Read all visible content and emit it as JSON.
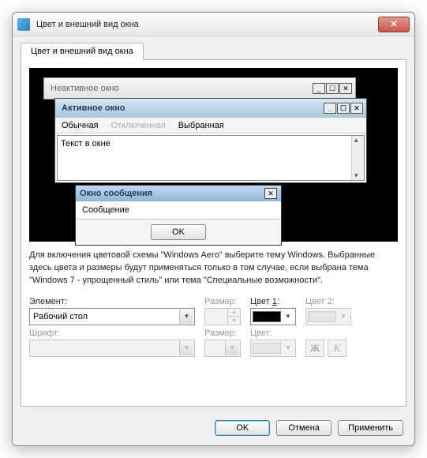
{
  "window": {
    "title": "Цвет и внешний вид окна",
    "close_glyph": "✕"
  },
  "tab": {
    "label": "Цвет и внешний вид окна"
  },
  "preview": {
    "inactive_title": "Неактивное окно",
    "active_title": "Активное окно",
    "menu_normal": "Обычная",
    "menu_disabled": "Отключенная",
    "menu_selected": "Выбранная",
    "window_text": "Текст в окне",
    "msgbox_title": "Окно сообщения",
    "msgbox_text": "Сообщение",
    "msgbox_ok": "OK",
    "min_glyph": "_",
    "max_glyph": "☐",
    "close_glyph": "✕"
  },
  "description": "Для включения цветовой схемы \"Windows Aero\" выберите тему Windows. Выбранные здесь цвета и размеры будут применяться только в том случае, если выбрана тема \"Windows 7 - упрощенный стиль\" или тема \"Специальные возможности\".",
  "form": {
    "element_label": "Элемент:",
    "element_value": "Рабочий стол",
    "size_label": "Размер:",
    "color1_label_pre": "Цвет ",
    "color1_label_u": "1",
    "color1_label_post": ":",
    "color2_label": "Цвет 2:",
    "font_label": "Шрифт:",
    "font_size_label": "Размер:",
    "font_color_label": "Цвет:",
    "bold_glyph": "Ж",
    "italic_glyph": "К",
    "color1_value": "#000000"
  },
  "buttons": {
    "ok": "OK",
    "cancel": "Отмена",
    "apply": "Применить"
  }
}
